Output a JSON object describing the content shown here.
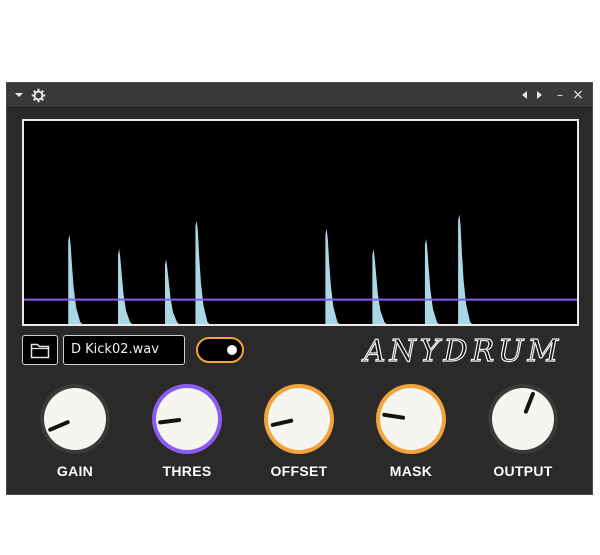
{
  "titlebar": {
    "menu_icon": "chevron-down-icon",
    "settings_icon": "gear-icon",
    "prev_icon": "triangle-left-icon",
    "next_icon": "triangle-right-icon",
    "minimize_glyph": "–",
    "close_glyph": "×"
  },
  "display": {
    "threshold_fraction": 0.88,
    "threshold_color": "#8a5cf5",
    "peak_color": "#a9d7e6",
    "peaks": [
      {
        "pos": 0.08,
        "height": 0.44
      },
      {
        "pos": 0.17,
        "height": 0.37
      },
      {
        "pos": 0.255,
        "height": 0.32
      },
      {
        "pos": 0.31,
        "height": 0.51
      },
      {
        "pos": 0.545,
        "height": 0.47
      },
      {
        "pos": 0.63,
        "height": 0.37
      },
      {
        "pos": 0.725,
        "height": 0.42
      },
      {
        "pos": 0.785,
        "height": 0.54
      }
    ]
  },
  "file": {
    "name": "D Kick02.wav",
    "browse_icon": "folder-icon"
  },
  "toggle": {
    "state": "on",
    "accent": "#f0a43a"
  },
  "logo": {
    "text": "ANYDRUM"
  },
  "knobs": [
    {
      "label": "GAIN",
      "ring": "#3a3a3a",
      "value": 0.08
    },
    {
      "label": "THRES",
      "ring": "#8a5cf5",
      "value": 0.14
    },
    {
      "label": "OFFSET",
      "ring": "#f0a43a",
      "value": 0.12
    },
    {
      "label": "MASK",
      "ring": "#f0a43a",
      "value": 0.2
    },
    {
      "label": "OUTPUT",
      "ring": "#3a3a3a",
      "value": 0.58
    }
  ]
}
